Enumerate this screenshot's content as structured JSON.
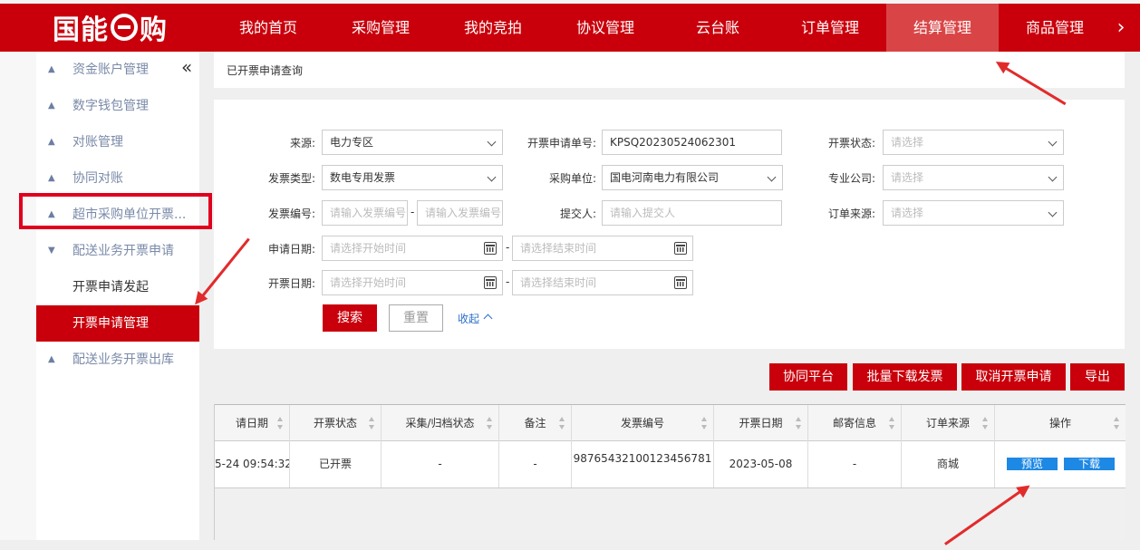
{
  "header": {
    "logo_text": "国能",
    "logo_suffix": "购",
    "nav": [
      "我的首页",
      "采购管理",
      "我的竞拍",
      "协议管理",
      "云台账",
      "订单管理",
      "结算管理",
      "商品管理"
    ],
    "active_nav": "结算管理",
    "next_icon": "chevron-right-icon"
  },
  "sidebar": {
    "items": [
      {
        "label": "资金账户管理",
        "icon": "triangle-up-icon"
      },
      {
        "label": "数字钱包管理",
        "icon": "triangle-up-icon"
      },
      {
        "label": "对账管理",
        "icon": "triangle-up-icon"
      },
      {
        "label": "协同对账",
        "icon": "triangle-up-icon"
      },
      {
        "label": "超市采购单位开票...",
        "icon": "triangle-up-icon"
      },
      {
        "label": "配送业务开票申请",
        "icon": "triangle-down-icon"
      },
      {
        "label": "开票申请发起",
        "sub": true
      },
      {
        "label": "开票申请管理",
        "sub": true,
        "selected": true
      },
      {
        "label": "配送业务开票出库",
        "icon": "triangle-up-icon"
      }
    ]
  },
  "breadcrumb": "已开票申请查询",
  "filters": {
    "source_label": "来源:",
    "source_value": "电力专区",
    "apply_no_label": "开票申请单号:",
    "apply_no_value": "KPSQ20230524062301",
    "status_label": "开票状态:",
    "status_placeholder": "请选择",
    "type_label": "发票类型:",
    "type_value": "数电专用发票",
    "buyer_label": "采购单位:",
    "buyer_value": "国电河南电力有限公司",
    "company_label": "专业公司:",
    "company_placeholder": "请选择",
    "invoice_no_label": "发票编号:",
    "invoice_no_placeholder": "请输入发票编号",
    "submitter_label": "提交人:",
    "submitter_placeholder": "请输入提交人",
    "order_source_label": "订单来源:",
    "order_source_placeholder": "请选择",
    "apply_date_label": "申请日期:",
    "open_date_label": "开票日期:",
    "start_placeholder": "请选择开始时间",
    "end_placeholder": "请选择结束时间",
    "search_label": "搜索",
    "reset_label": "重置",
    "collapse_label": "收起"
  },
  "actions": [
    "协同平台",
    "批量下载发票",
    "取消开票申请",
    "导出"
  ],
  "table": {
    "columns": [
      "请日期",
      "开票状态",
      "采集/归档状态",
      "备注",
      "发票编号",
      "开票日期",
      "邮寄信息",
      "订单来源",
      "操作"
    ],
    "rows": [
      {
        "apply_date": "5-24 09:54:32",
        "status": "已开票",
        "archive": "-",
        "remark": "-",
        "invoice_no": "98765432100123456781",
        "open_date": "2023-05-08",
        "mail": "-",
        "order_source": "商城",
        "preview": "预览",
        "download": "下载"
      }
    ]
  },
  "colors": {
    "brand": "#c9000b",
    "link": "#2a6fc9",
    "op_button": "#1e88e5",
    "annotation": "#e12b2b"
  }
}
